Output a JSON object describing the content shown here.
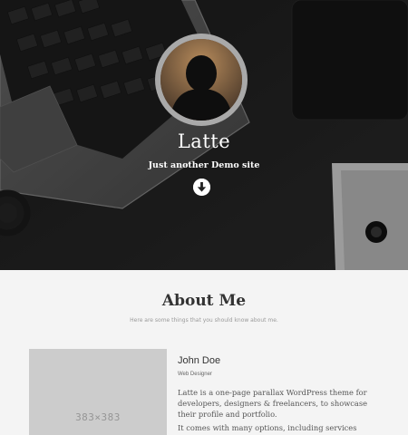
{
  "hero": {
    "site_title": "Latte",
    "tagline": "Just another Demo site",
    "scroll_icon": "arrow-down-circle-icon"
  },
  "about": {
    "title": "About Me",
    "subtitle": "Here are some things that you should know about me.",
    "photo_placeholder": "383×383",
    "name": "John Doe",
    "role": "Web Designer",
    "bio": "Latte is a one-page parallax WordPress theme for developers, designers & freelancers, to showcase their profile and portfolio.",
    "bio_more": "It comes with many options, including services"
  },
  "colors": {
    "page_bg": "#f4f4f4",
    "avatar_ring": "#a9a9a9",
    "placeholder_bg": "#cccccc"
  }
}
